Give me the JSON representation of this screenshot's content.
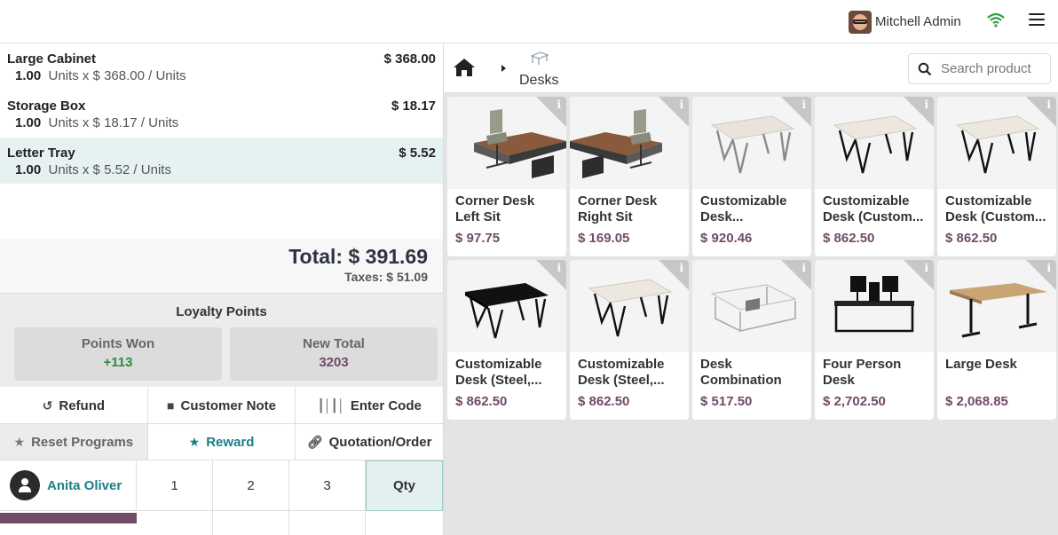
{
  "topbar": {
    "user_name": "Mitchell Admin"
  },
  "order": {
    "lines": [
      {
        "name": "Large Cabinet",
        "qty": "1.00",
        "unit_text": "Units x $ 368.00 / Units",
        "price": "$ 368.00"
      },
      {
        "name": "Storage Box",
        "qty": "1.00",
        "unit_text": "Units x $ 18.17 / Units",
        "price": "$ 18.17"
      },
      {
        "name": "Letter Tray",
        "qty": "1.00",
        "unit_text": "Units x $ 5.52 / Units",
        "price": "$ 5.52"
      }
    ],
    "total": "Total: $ 391.69",
    "taxes": "Taxes: $ 51.09"
  },
  "loyalty": {
    "title": "Loyalty Points",
    "points_won_label": "Points Won",
    "points_won_value": "+113",
    "new_total_label": "New Total",
    "new_total_value": "3203",
    "points_won_color": "#2e8b3a",
    "new_total_color": "#714b67"
  },
  "controls": {
    "refund": "Refund",
    "customer_note": "Customer Note",
    "enter_code": "Enter Code",
    "reset_programs": "Reset Programs",
    "reward": "Reward",
    "quotation_order": "Quotation/Order"
  },
  "numpad": {
    "customer": "Anita Oliver",
    "keys": [
      "1",
      "2",
      "3"
    ],
    "qty": "Qty"
  },
  "products_panel": {
    "category": "Desks",
    "search_placeholder": "Search product",
    "products": [
      {
        "name": "Corner Desk Left Sit",
        "price": "$ 97.75",
        "image": "corner-desk-left-icon"
      },
      {
        "name": "Corner Desk Right Sit",
        "price": "$ 169.05",
        "image": "corner-desk-right-icon"
      },
      {
        "name": "Customizable Desk...",
        "price": "$ 920.46",
        "image": "white-desk-grey-legs-icon"
      },
      {
        "name": "Customizable Desk (Custom...",
        "price": "$ 862.50",
        "image": "white-desk-black-legs-icon"
      },
      {
        "name": "Customizable Desk (Custom...",
        "price": "$ 862.50",
        "image": "white-desk-black-legs-icon"
      },
      {
        "name": "Customizable Desk (Steel,...",
        "price": "$ 862.50",
        "image": "black-desk-icon"
      },
      {
        "name": "Customizable Desk (Steel,...",
        "price": "$ 862.50",
        "image": "white-desk-black-legs-icon"
      },
      {
        "name": "Desk Combination",
        "price": "$ 517.50",
        "image": "desk-combination-icon"
      },
      {
        "name": "Four Person Desk",
        "price": "$ 2,702.50",
        "image": "four-person-desk-icon"
      },
      {
        "name": "Large Desk",
        "price": "$ 2,068.85",
        "image": "large-desk-icon"
      }
    ]
  },
  "colors": {
    "accent_teal": "#1a7f86",
    "brand_purple": "#714b67"
  }
}
